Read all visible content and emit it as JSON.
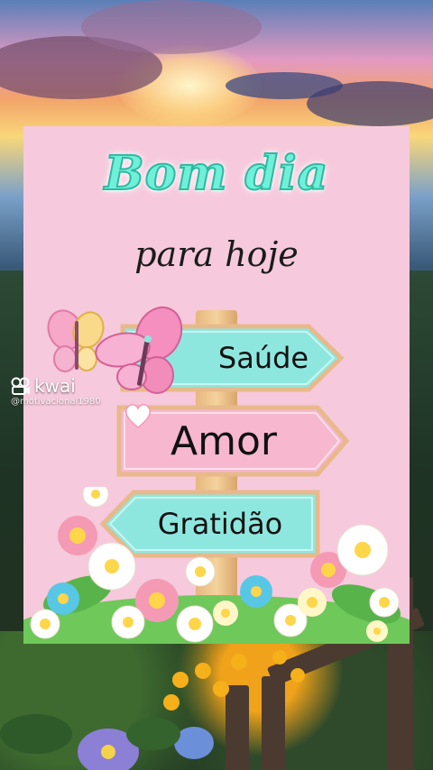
{
  "card": {
    "title": "Bom dia",
    "subtitle": "para hoje",
    "signs": [
      {
        "label": "Saúde",
        "color": "#8ee7df"
      },
      {
        "label": "Amor",
        "color": "#f7b7cf"
      },
      {
        "label": "Gratidão",
        "color": "#8ee7df"
      }
    ]
  },
  "watermark": {
    "brand": "kwai",
    "handle": "@motivacional1980",
    "icon": "kwai-logo-icon"
  },
  "colors": {
    "card_background": "#f6c9dc",
    "title_color": "#6ff0d8",
    "post_color": "#e6b77f"
  }
}
